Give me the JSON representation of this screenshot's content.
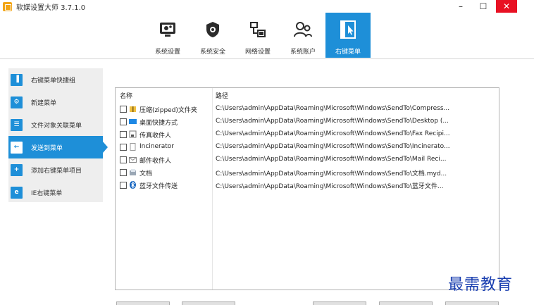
{
  "window": {
    "title": "软媒设置大师 3.7.1.0",
    "minimize": "–",
    "maximize": "☐",
    "close": "✕"
  },
  "toolbar": {
    "items": [
      {
        "label": "系统设置",
        "icon": "system-settings-icon"
      },
      {
        "label": "系统安全",
        "icon": "shield-icon"
      },
      {
        "label": "网络设置",
        "icon": "network-icon"
      },
      {
        "label": "系统账户",
        "icon": "users-icon"
      },
      {
        "label": "右键菜单",
        "icon": "cursor-icon",
        "active": true
      }
    ]
  },
  "sidebar": {
    "items": [
      {
        "label": "右键菜单快捷组",
        "icon": "menu-group-icon"
      },
      {
        "label": "新建菜单",
        "icon": "new-menu-icon"
      },
      {
        "label": "文件对象关联菜单",
        "icon": "file-assoc-icon"
      },
      {
        "label": "发送到菜单",
        "icon": "send-to-icon",
        "active": true
      },
      {
        "label": "添加右键菜单项目",
        "icon": "add-icon"
      },
      {
        "label": "IE右键菜单",
        "icon": "ie-icon"
      }
    ]
  },
  "list": {
    "headers": {
      "name": "名称",
      "path": "路径"
    },
    "rows": [
      {
        "name": "压缩(zipped)文件夹",
        "path": "C:\\Users\\admin\\AppData\\Roaming\\Microsoft\\Windows\\SendTo\\Compress...",
        "icon": "zip-folder-icon",
        "checked": false
      },
      {
        "name": "桌面快捷方式",
        "path": "C:\\Users\\admin\\AppData\\Roaming\\Microsoft\\Windows\\SendTo\\Desktop (...",
        "icon": "desktop-icon",
        "checked": false
      },
      {
        "name": "传真收件人",
        "path": "C:\\Users\\admin\\AppData\\Roaming\\Microsoft\\Windows\\SendTo\\Fax Recipi...",
        "icon": "fax-icon",
        "checked": false
      },
      {
        "name": "Incinerator",
        "path": "C:\\Users\\admin\\AppData\\Roaming\\Microsoft\\Windows\\SendTo\\Incinerato...",
        "icon": "blank-file-icon",
        "checked": false
      },
      {
        "name": "邮件收件人",
        "path": "C:\\Users\\admin\\AppData\\Roaming\\Microsoft\\Windows\\SendTo\\Mail Reci...",
        "icon": "mail-icon",
        "checked": false
      },
      {
        "name": "文档",
        "path": "C:\\Users\\admin\\AppData\\Roaming\\Microsoft\\Windows\\SendTo\\文档.myd...",
        "icon": "documents-icon",
        "checked": false
      },
      {
        "name": "蓝牙文件传送",
        "path": "C:\\Users\\admin\\AppData\\Roaming\\Microsoft\\Windows\\SendTo\\蓝牙文件...",
        "icon": "bluetooth-icon",
        "checked": false
      }
    ]
  },
  "watermark": "最需教育",
  "colors": {
    "accent": "#1e8fd8",
    "close": "#e81123",
    "sidebar_bg": "#eeeeee",
    "watermark": "#1a3fb0"
  }
}
